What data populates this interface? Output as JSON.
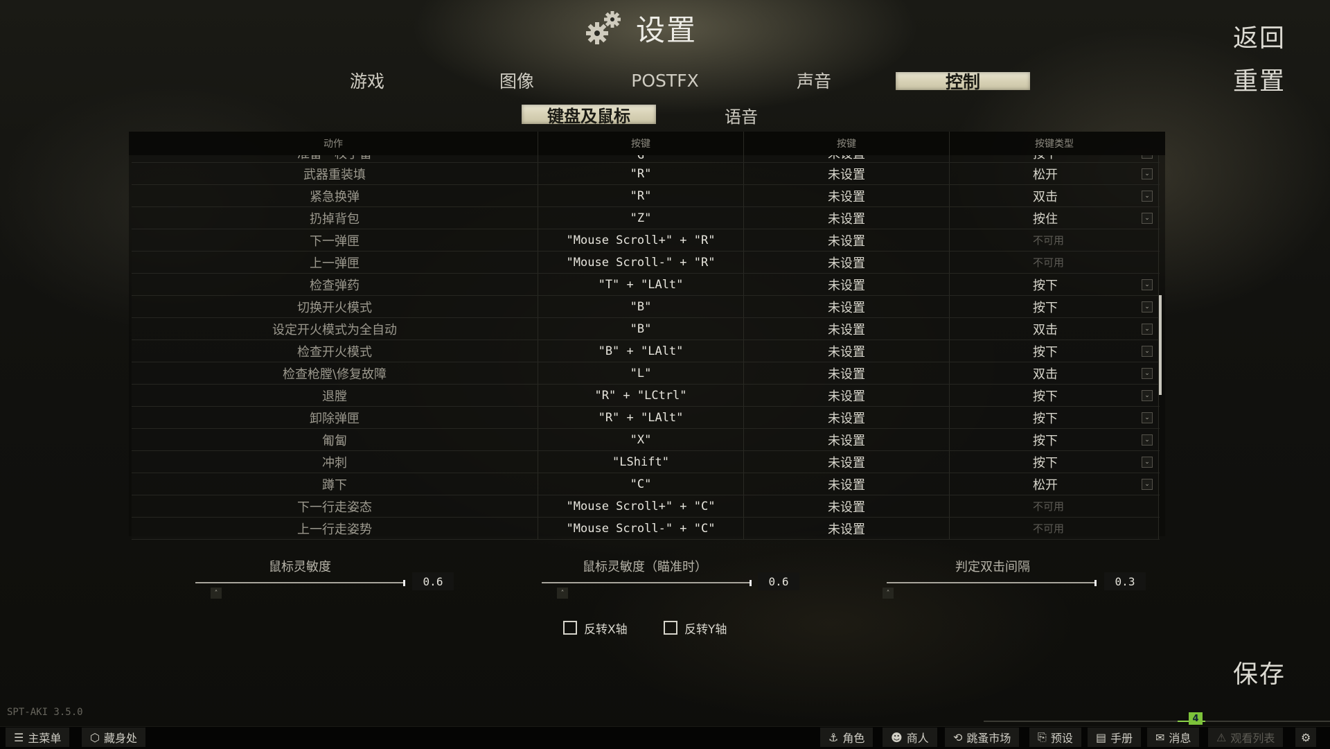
{
  "header": {
    "title": "设置",
    "back": "返回",
    "reset": "重置",
    "save": "保存"
  },
  "tabs": [
    "游戏",
    "图像",
    "POSTFX",
    "声音",
    "控制"
  ],
  "subtabs": [
    "键盘及鼠标",
    "语音"
  ],
  "table": {
    "headers": [
      "动作",
      "按键",
      "按键",
      "按键类型"
    ],
    "partial_row": {
      "action": "准备一枚手雷",
      "key1": "\"G\"",
      "key2": "未设置",
      "type": "按下"
    },
    "rows": [
      {
        "action": "武器重装填",
        "key1": "\"R\"",
        "key2": "未设置",
        "type": "松开"
      },
      {
        "action": "紧急换弹",
        "key1": "\"R\"",
        "key2": "未设置",
        "type": "双击"
      },
      {
        "action": "扔掉背包",
        "key1": "\"Z\"",
        "key2": "未设置",
        "type": "按住"
      },
      {
        "action": "下一弹匣",
        "key1": "\"Mouse Scroll+\" + \"R\"",
        "key2": "未设置",
        "type": "不可用"
      },
      {
        "action": "上一弹匣",
        "key1": "\"Mouse Scroll-\" + \"R\"",
        "key2": "未设置",
        "type": "不可用"
      },
      {
        "action": "检查弹药",
        "key1": "\"T\" + \"LAlt\"",
        "key2": "未设置",
        "type": "按下"
      },
      {
        "action": "切换开火模式",
        "key1": "\"B\"",
        "key2": "未设置",
        "type": "按下"
      },
      {
        "action": "设定开火模式为全自动",
        "key1": "\"B\"",
        "key2": "未设置",
        "type": "双击"
      },
      {
        "action": "检查开火模式",
        "key1": "\"B\" + \"LAlt\"",
        "key2": "未设置",
        "type": "按下"
      },
      {
        "action": "检查枪膛\\修复故障",
        "key1": "\"L\"",
        "key2": "未设置",
        "type": "双击"
      },
      {
        "action": "退膛",
        "key1": "\"R\" + \"LCtrl\"",
        "key2": "未设置",
        "type": "按下"
      },
      {
        "action": "卸除弹匣",
        "key1": "\"R\" + \"LAlt\"",
        "key2": "未设置",
        "type": "按下"
      },
      {
        "action": "匍匐",
        "key1": "\"X\"",
        "key2": "未设置",
        "type": "按下"
      },
      {
        "action": "冲刺",
        "key1": "\"LShift\"",
        "key2": "未设置",
        "type": "按下"
      },
      {
        "action": "蹲下",
        "key1": "\"C\"",
        "key2": "未设置",
        "type": "松开"
      },
      {
        "action": "下一行走姿态",
        "key1": "\"Mouse Scroll+\" + \"C\"",
        "key2": "未设置",
        "type": "不可用"
      },
      {
        "action": "上一行走姿势",
        "key1": "\"Mouse Scroll-\" + \"C\"",
        "key2": "未设置",
        "type": "不可用"
      }
    ]
  },
  "sliders": [
    {
      "label": "鼠标灵敏度",
      "value": "0.6",
      "level": 1.0
    },
    {
      "label": "鼠标灵敏度（瞄准时）",
      "value": "0.6",
      "level": 1.0
    },
    {
      "label": "判定双击间隔",
      "value": "0.3",
      "level": 1.0
    }
  ],
  "checkboxes": [
    {
      "label": "反转X轴",
      "checked": false
    },
    {
      "label": "反转Y轴",
      "checked": false
    }
  ],
  "version": "SPT-AKI 3.5.0",
  "notification_count": "4",
  "bottom_bar": {
    "main_menu": "主菜单",
    "hideout": "藏身处",
    "character": "角色",
    "traders": "商人",
    "flea_market": "跳蚤市场",
    "presets": "预设",
    "handbook": "手册",
    "messages": "消息",
    "watchlist": "观看列表"
  }
}
